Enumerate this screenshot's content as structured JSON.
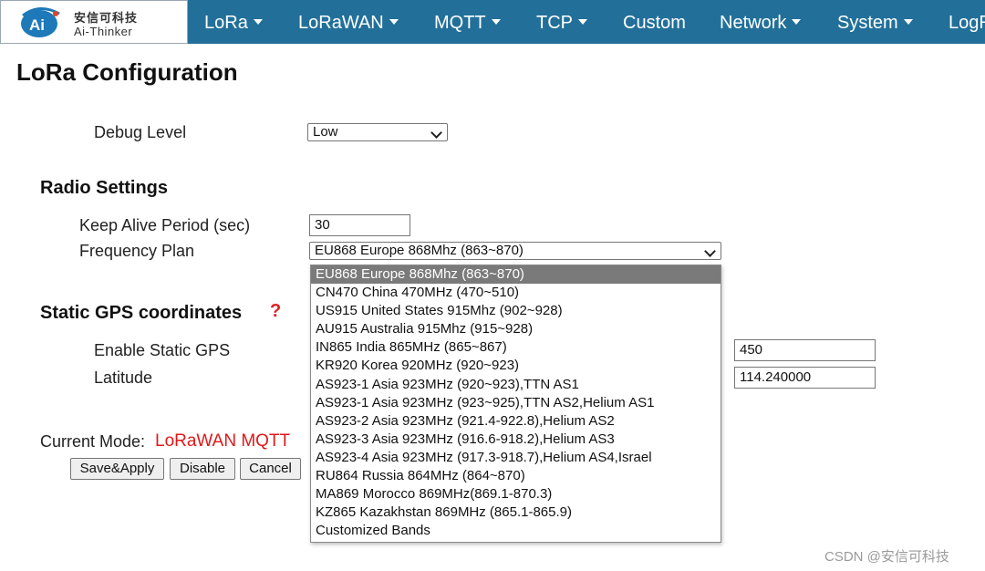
{
  "logo": {
    "cn": "安信可科技",
    "en": "Ai-Thinker",
    "mark": "Ai"
  },
  "nav": [
    {
      "label": "LoRa",
      "dropdown": true
    },
    {
      "label": "LoRaWAN",
      "dropdown": true
    },
    {
      "label": "MQTT",
      "dropdown": true
    },
    {
      "label": "TCP",
      "dropdown": true
    },
    {
      "label": "Custom",
      "dropdown": false
    },
    {
      "label": "Network",
      "dropdown": true
    },
    {
      "label": "System",
      "dropdown": true
    },
    {
      "label": "LogR",
      "dropdown": false
    }
  ],
  "page": {
    "title": "LoRa Configuration"
  },
  "debug": {
    "label": "Debug Level",
    "value": "Low"
  },
  "radio": {
    "heading": "Radio Settings",
    "keepalive_label": "Keep Alive Period (sec)",
    "keepalive_value": "30",
    "freq_label": "Frequency Plan",
    "freq_value": "EU868 Europe 868Mhz (863~870)"
  },
  "gps": {
    "heading": "Static GPS coordinates",
    "help": "?",
    "enable_label": "Enable Static GPS",
    "latitude_label": "Latitude",
    "altitude_value": "450",
    "longitude_value": "114.240000"
  },
  "mode": {
    "label": "Current Mode:",
    "value": "LoRaWAN MQTT"
  },
  "buttons": {
    "save": "Save&Apply",
    "disable": "Disable",
    "cancel": "Cancel"
  },
  "freq_options": [
    "EU868 Europe 868Mhz (863~870)",
    "CN470 China 470MHz (470~510)",
    "US915 United States 915Mhz (902~928)",
    "AU915 Australia 915Mhz (915~928)",
    "IN865 India 865MHz (865~867)",
    "KR920 Korea 920MHz (920~923)",
    "AS923-1 Asia 923MHz (920~923),TTN AS1",
    "AS923-1 Asia 923MHz (923~925),TTN AS2,Helium AS1",
    "AS923-2 Asia 923MHz (921.4-922.8),Helium AS2",
    "AS923-3 Asia 923MHz (916.6-918.2),Helium AS3",
    "AS923-4 Asia 923MHz (917.3-918.7),Helium AS4,Israel",
    "RU864 Russia 864MHz (864~870)",
    "MA869 Morocco 869MHz(869.1-870.3)",
    "KZ865 Kazakhstan 869MHz (865.1-865.9)",
    "Customized Bands"
  ],
  "watermark": "CSDN @安信可科技",
  "colors": {
    "header_bg": "#22709a",
    "mode_value": "#e01818",
    "selected_option": "#7a7a7a"
  }
}
